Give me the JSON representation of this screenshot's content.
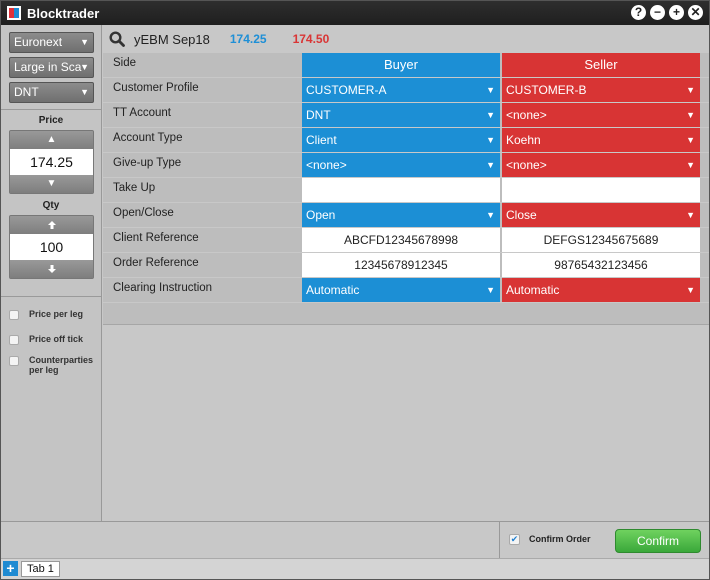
{
  "window": {
    "title": "Blocktrader"
  },
  "window_controls": {
    "help": "?",
    "minimize": "−",
    "maximize": "+",
    "close": "✕"
  },
  "sidebar": {
    "market": "Euronext",
    "block_type": "Large in Sca",
    "account": "DNT",
    "price_label": "Price",
    "price_value": "174.25",
    "qty_label": "Qty",
    "qty_value": "100",
    "options": [
      {
        "label": "Price per leg",
        "checked": false
      },
      {
        "label": "Price off tick",
        "checked": false
      },
      {
        "label": "Counterparties per leg",
        "checked": false
      }
    ]
  },
  "instrument": {
    "name": "yEBM Sep18",
    "bid": "174.25",
    "ask": "174.50"
  },
  "grid": {
    "rows": [
      {
        "label": "Side",
        "buyer": "Buyer",
        "seller": "Seller"
      },
      {
        "label": "Customer Profile",
        "buyer": "CUSTOMER-A",
        "seller": "CUSTOMER-B"
      },
      {
        "label": "TT Account",
        "buyer": "DNT",
        "seller": "<none>"
      },
      {
        "label": "Account Type",
        "buyer": "Client",
        "seller": "Koehn"
      },
      {
        "label": "Give-up Type",
        "buyer": "<none>",
        "seller": "<none>"
      },
      {
        "label": "Take Up",
        "buyer": "",
        "seller": ""
      },
      {
        "label": "Open/Close",
        "buyer": "Open",
        "seller": "Close"
      },
      {
        "label": "Client Reference",
        "buyer": "ABCFD12345678998",
        "seller": "DEFGS12345675689"
      },
      {
        "label": "Order Reference",
        "buyer": "12345678912345",
        "seller": "98765432123456"
      },
      {
        "label": "Clearing Instruction",
        "buyer": "Automatic",
        "seller": "Automatic"
      }
    ]
  },
  "footer": {
    "confirm_order_label": "Confirm Order",
    "confirm_order_checked": true,
    "confirm_button": "Confirm"
  },
  "tabs": [
    {
      "label": "Tab 1"
    }
  ],
  "colors": {
    "buyer": "#1c8fd5",
    "seller": "#d83434",
    "confirm": "#4fba45"
  }
}
